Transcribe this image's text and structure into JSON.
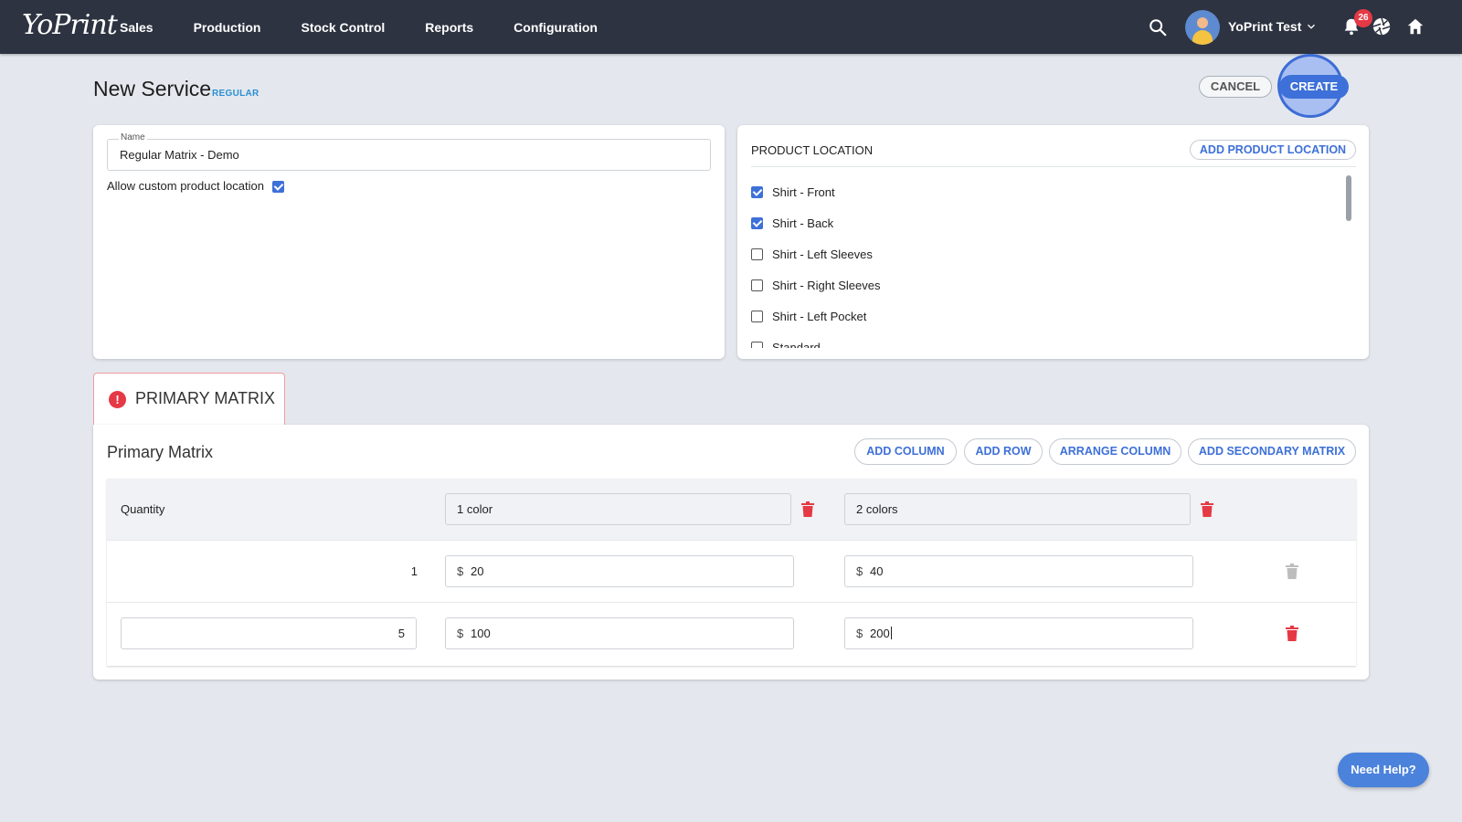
{
  "app": {
    "logo": "YoPrint"
  },
  "nav": {
    "items": [
      "Sales",
      "Production",
      "Stock Control",
      "Reports",
      "Configuration"
    ]
  },
  "user": {
    "name": "YoPrint Test",
    "notifications": "26"
  },
  "page": {
    "title": "New Service",
    "tag": "REGULAR",
    "cancel_label": "CANCEL",
    "create_label": "CREATE"
  },
  "name_card": {
    "field_label": "Name",
    "field_value": "Regular Matrix - Demo",
    "allow_custom_label": "Allow custom product location",
    "allow_custom_checked": true
  },
  "location_card": {
    "title": "PRODUCT LOCATION",
    "add_label": "ADD PRODUCT LOCATION",
    "items": [
      {
        "label": "Shirt - Front",
        "checked": true
      },
      {
        "label": "Shirt - Back",
        "checked": true
      },
      {
        "label": "Shirt - Left Sleeves",
        "checked": false
      },
      {
        "label": "Shirt - Right Sleeves",
        "checked": false
      },
      {
        "label": "Shirt - Left Pocket",
        "checked": false
      },
      {
        "label": "Standard",
        "checked": false
      }
    ]
  },
  "tab": {
    "label": "PRIMARY MATRIX",
    "error_glyph": "!"
  },
  "matrix": {
    "title": "Primary Matrix",
    "buttons": {
      "add_column": "ADD COLUMN",
      "add_row": "ADD ROW",
      "arrange_column": "ARRANGE COLUMN",
      "add_secondary": "ADD SECONDARY MATRIX"
    },
    "quantity_label": "Quantity",
    "columns": [
      "1 color",
      "2 colors"
    ],
    "currency": "$",
    "rows": [
      {
        "quantity": "1",
        "values": [
          "20",
          "40"
        ]
      },
      {
        "quantity": "5",
        "values": [
          "100",
          "200"
        ]
      }
    ]
  },
  "help": {
    "label": "Need Help?"
  },
  "colors": {
    "topbar": "#2d3340",
    "accent": "#3d70d8",
    "danger": "#e53946",
    "tag": "#2b8fd2"
  },
  "icons": [
    "search-icon",
    "chevron-down-icon",
    "bell-icon",
    "aperture-icon",
    "home-icon",
    "check-icon",
    "trash-icon",
    "error-icon"
  ]
}
